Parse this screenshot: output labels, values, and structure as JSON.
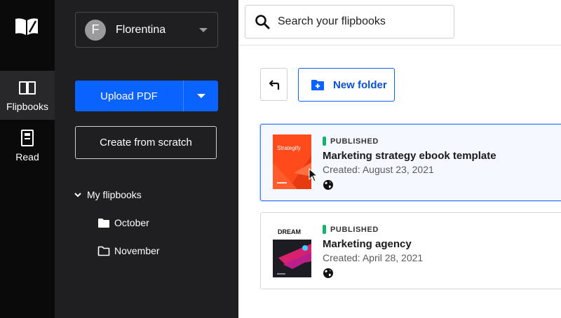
{
  "rail": {
    "items": [
      {
        "label": "Flipbooks",
        "icon": "book-open-icon",
        "active": true
      },
      {
        "label": "Read",
        "icon": "document-icon",
        "active": false
      }
    ]
  },
  "sidebar": {
    "user": {
      "initial": "F",
      "name": "Florentina"
    },
    "upload_label": "Upload PDF",
    "create_label": "Create from scratch",
    "tree": {
      "root_label": "My flipbooks",
      "folders": [
        {
          "label": "October",
          "icon": "folder-filled-icon"
        },
        {
          "label": "November",
          "icon": "folder-outline-icon"
        }
      ]
    }
  },
  "search": {
    "placeholder": "Search your flipbooks"
  },
  "toolbar": {
    "new_folder_label": "New folder"
  },
  "cards": [
    {
      "status": "PUBLISHED",
      "title": "Marketing strategy ebook template",
      "created": "Created: August 23, 2021",
      "thumb_text": "Strategify",
      "selected": true
    },
    {
      "status": "PUBLISHED",
      "title": "Marketing agency",
      "created": "Created: April 28, 2021",
      "thumb_text": "DREAM",
      "selected": false
    }
  ],
  "colors": {
    "accent": "#0a63ff",
    "published": "#17b26a",
    "rail_bg": "#0a0a0a",
    "sidebar_bg": "#1f1f21"
  }
}
